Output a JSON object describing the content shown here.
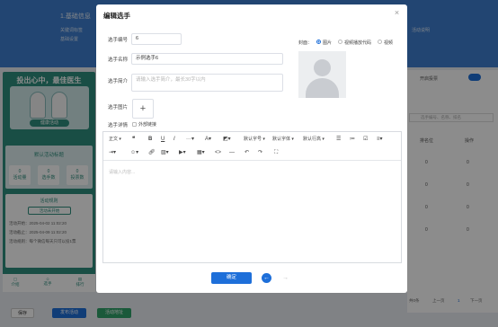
{
  "background": {
    "header_title": "1.基础信息",
    "header_sub1": "关键词标签",
    "header_sub2": "基础设置",
    "header_right_sub": "活动说明",
    "slogan": "投出心中，最佳医生",
    "ribbon": "健康活动",
    "stats_title": "默认活动标题",
    "stats": [
      {
        "value": "0",
        "label": "活动量"
      },
      {
        "value": "0",
        "label": "选手数"
      },
      {
        "value": "0",
        "label": "投票数"
      }
    ],
    "activity_section": "活动规则",
    "activity_button": "活动未开始",
    "activity_lines": [
      "活动开始：2025-04-02 11:02:20",
      "活动截止：2025-04-09 11:02:20",
      "活动规则：每个微信每天只可以投1票"
    ],
    "tabs": [
      "介绍",
      "选手",
      "排行"
    ],
    "bottom_buttons": [
      "保存",
      "发布活动",
      "活动地址"
    ],
    "switch_label": "开启投票",
    "search_placeholder": "选手编号、名称、排名",
    "table_headers": [
      "排名位",
      "操作"
    ],
    "table_values": [
      "0",
      "0",
      "0",
      "0",
      "0",
      "0",
      "0",
      "0"
    ],
    "pagination": {
      "total": "共0条",
      "prev": "上一页",
      "page": "1",
      "next": "下一页"
    }
  },
  "dialog": {
    "title": "编辑选手",
    "fields": {
      "number_label": "选手编号",
      "number_value": "6",
      "name_label": "选手名称",
      "name_value": "示例选手6",
      "intro_label": "选手简介",
      "intro_placeholder": "请输入选手简介，最长30字以内",
      "image_label": "选手图片",
      "review_label": "选手详情",
      "external_link_label": "外部链接"
    },
    "cover": {
      "label": "封面：",
      "options": [
        "图片",
        "视频播放代码",
        "视频"
      ],
      "selected": "图片"
    },
    "toolbar": {
      "row1": [
        "正文",
        "默认字号",
        "默认字体",
        "默认行高"
      ],
      "icons": [
        "quote-icon",
        "bold-icon",
        "underline-icon",
        "italic-icon",
        "more-icon",
        "font-color-icon",
        "bg-color-icon",
        "bullet-list-icon",
        "numbered-list-icon",
        "todo-icon",
        "align-icon",
        "indent-icon",
        "emoji-icon",
        "link-icon",
        "image-icon",
        "video-icon",
        "table-icon",
        "code-icon",
        "divider-icon",
        "undo-icon",
        "redo-icon",
        "fullscreen-icon"
      ]
    },
    "editor_placeholder": "请输入内容...",
    "confirm": "确定"
  }
}
